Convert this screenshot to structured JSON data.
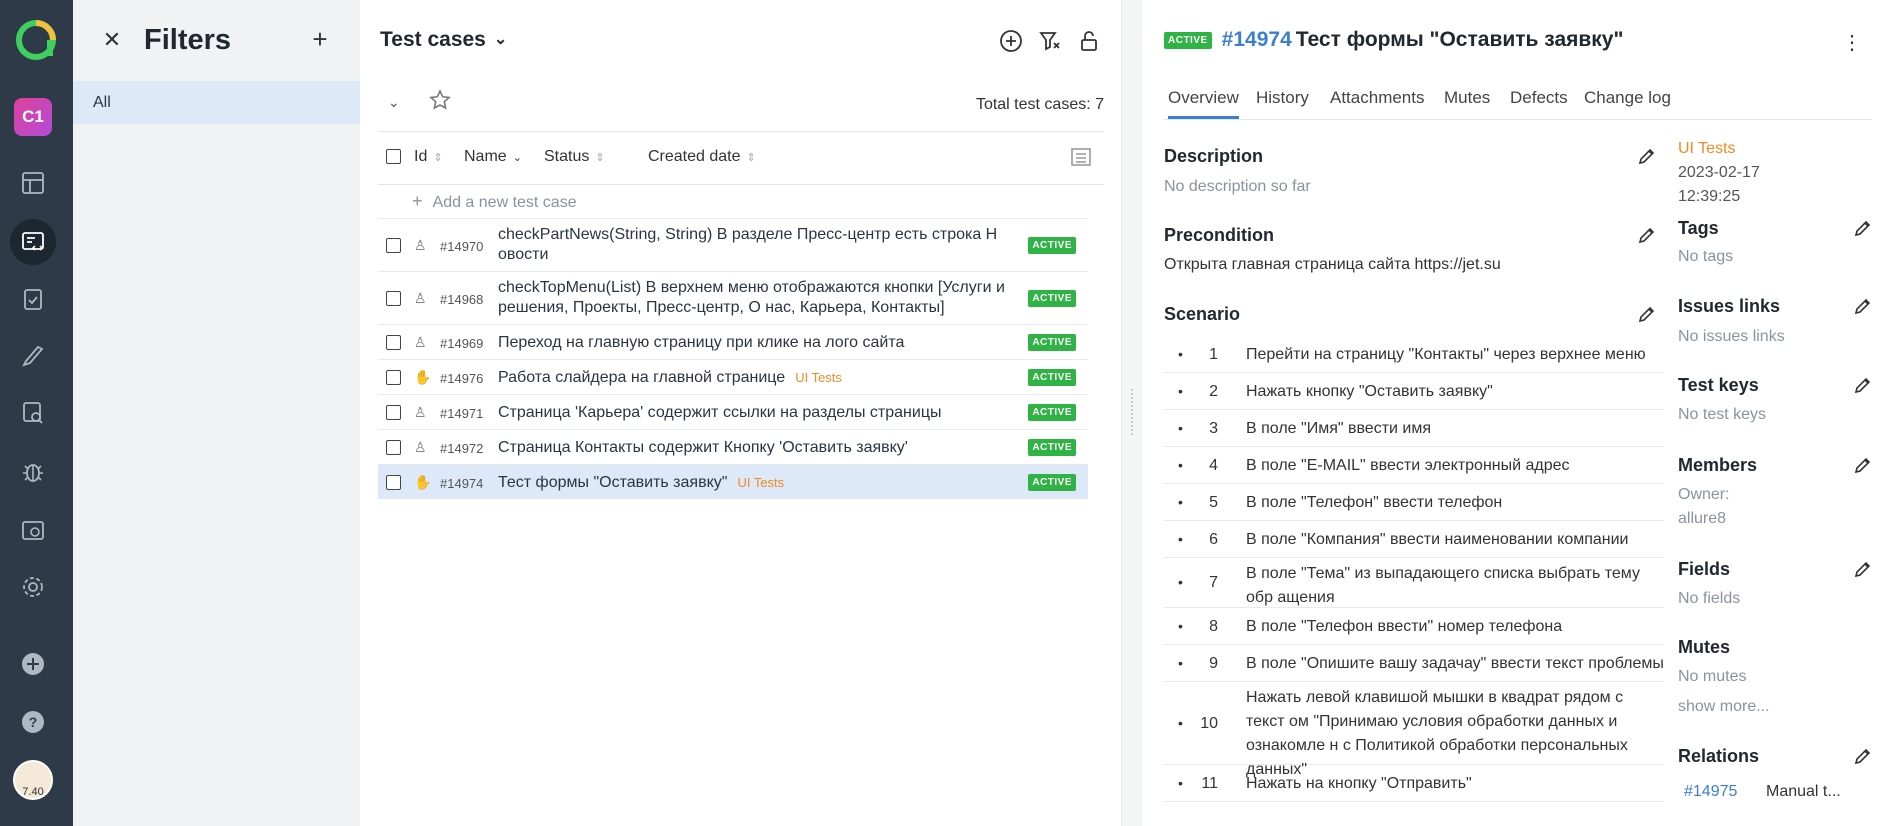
{
  "rail": {
    "project_initials": "C1",
    "avatar_text": "7.40"
  },
  "filters": {
    "title": "Filters",
    "items": [
      "All"
    ]
  },
  "list": {
    "title": "Test cases",
    "total_label": "Total test cases: 7",
    "columns": {
      "id": "Id",
      "name": "Name",
      "status": "Status",
      "created": "Created date"
    },
    "add_placeholder": "Add a new test case",
    "rows": [
      {
        "id": "#14970",
        "name": "checkPartNews(String, String) В разделе Пресс-центр есть строка Н овости",
        "tag": "",
        "badge": "ACTIVE",
        "icon": "user-icon",
        "selected": false
      },
      {
        "id": "#14968",
        "name": "checkTopMenu(List) В верхнем меню отображаются кнопки [Услуги и решения, Проекты, Пресс-центр, О нас, Карьера, Контакты]",
        "tag": "",
        "badge": "ACTIVE",
        "icon": "user-icon",
        "selected": false
      },
      {
        "id": "#14969",
        "name": "Переход на главную страницу при клике на лого сайта",
        "tag": "",
        "badge": "ACTIVE",
        "icon": "user-icon",
        "selected": false
      },
      {
        "id": "#14976",
        "name": "Работа слайдера на главной странице",
        "tag": "UI Tests",
        "badge": "ACTIVE",
        "icon": "hand-icon",
        "selected": false
      },
      {
        "id": "#14971",
        "name": "Страница 'Карьера' содержит ссылки на разделы страницы",
        "tag": "",
        "badge": "ACTIVE",
        "icon": "user-icon",
        "selected": false
      },
      {
        "id": "#14972",
        "name": "Страница Контакты содержит Кнопку 'Оставить заявку'",
        "tag": "",
        "badge": "ACTIVE",
        "icon": "user-icon",
        "selected": false
      },
      {
        "id": "#14974",
        "name": "Тест формы \"Оставить заявку\"",
        "tag": "UI Tests",
        "badge": "ACTIVE",
        "icon": "hand-icon",
        "selected": true
      }
    ]
  },
  "detail": {
    "badge": "ACTIVE",
    "number": "#14974",
    "title": "Тест формы \"Оставить заявку\"",
    "tabs": [
      "Overview",
      "History",
      "Attachments",
      "Mutes",
      "Defects",
      "Change log"
    ],
    "description": {
      "title": "Description",
      "value": "No description so far"
    },
    "precondition": {
      "title": "Precondition",
      "value": "Открыта главная страница сайта https://jet.su"
    },
    "scenario": {
      "title": "Scenario",
      "steps": [
        "Перейти на страницу \"Контакты\" через верхнее меню",
        "Нажать кнопку \"Оставить заявку\"",
        "В поле \"Имя\" ввести имя",
        "В поле \"E-MAIL\"  ввести электронный адрес",
        "В поле \"Телефон\" ввести телефон",
        "В поле \"Компания\" ввести наименовании компании",
        "В поле \"Тема\" из выпадающего списка выбрать тему обр ащения",
        "В поле \"Телефон ввести\" номер телефона",
        "В поле \"Опишите вашу задачау\" ввести текст проблемы",
        "Нажать левой клавишой мышки  в квадрат рядом с текст ом \"Принимаю условия обработки данных и ознакомле н с Политикой обработки персональных данных\"",
        "Нажать на кнопку \"Отправить\""
      ]
    },
    "side": {
      "layer": "UI Tests",
      "created_date": "2023-02-17",
      "created_time": "12:39:25",
      "tags": {
        "title": "Tags",
        "value": "No tags"
      },
      "issues": {
        "title": "Issues links",
        "value": "No issues links"
      },
      "test_keys": {
        "title": "Test keys",
        "value": "No test keys"
      },
      "members": {
        "title": "Members",
        "owner_label": "Owner:",
        "owner": "allure8"
      },
      "fields": {
        "title": "Fields",
        "value": "No fields"
      },
      "mutes": {
        "title": "Mutes",
        "value": "No mutes",
        "more": "show more..."
      },
      "relations": {
        "title": "Relations",
        "link": "#14975",
        "link_text": "Manual t..."
      }
    }
  },
  "colors": {
    "accent": "#3b7fd4",
    "active_badge": "#2fb344",
    "tag": "#f08a24",
    "rail": "#2e3a47",
    "selection": "#dde9f8"
  }
}
